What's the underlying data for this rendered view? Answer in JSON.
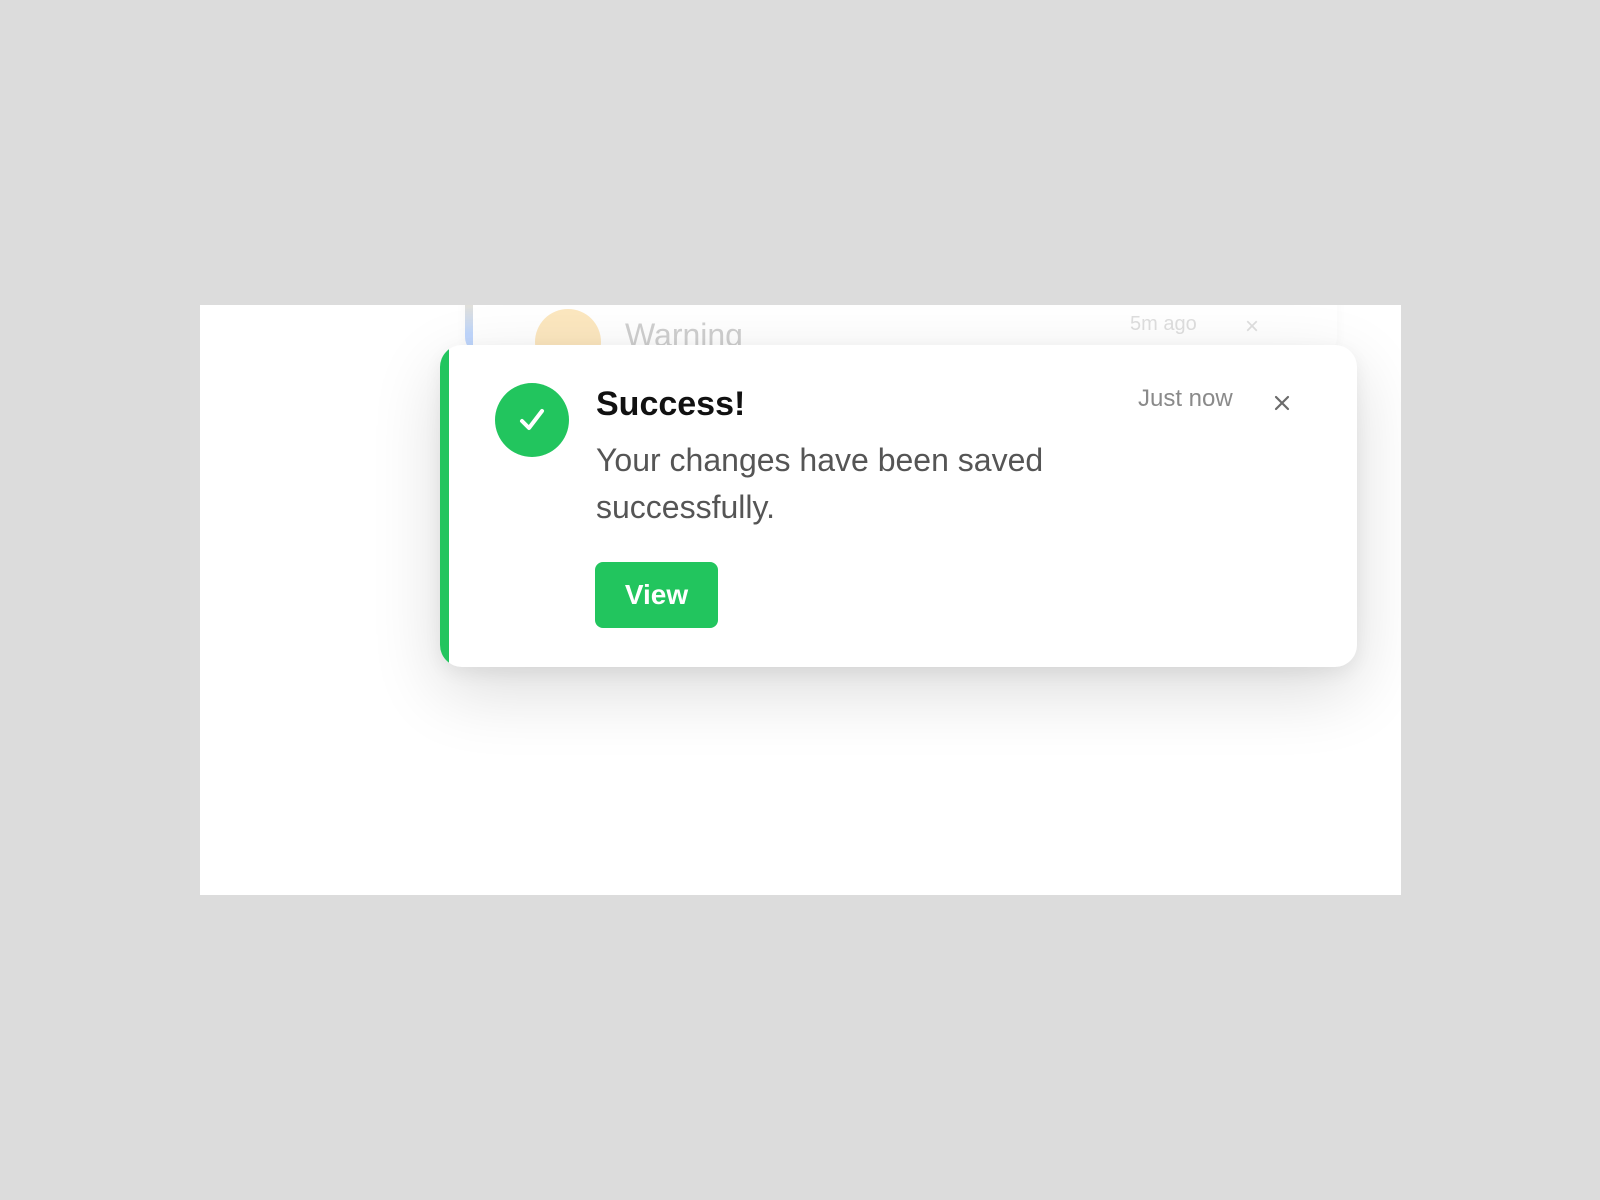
{
  "colors": {
    "page_background": "#dcdcdc",
    "panel_background": "#ffffff",
    "success_accent": "#22c55e",
    "warning_accent": "#f6b73c",
    "info_accent": "#3b82f6"
  },
  "background_toast": {
    "title": "Warning",
    "time": "5m ago",
    "close_label": "×",
    "icon": "warning-icon"
  },
  "toast": {
    "title": "Success!",
    "message": "Your changes have been saved successfully.",
    "time": "Just now",
    "action_label": "View",
    "icon": "check-icon",
    "close_icon": "close-icon"
  }
}
